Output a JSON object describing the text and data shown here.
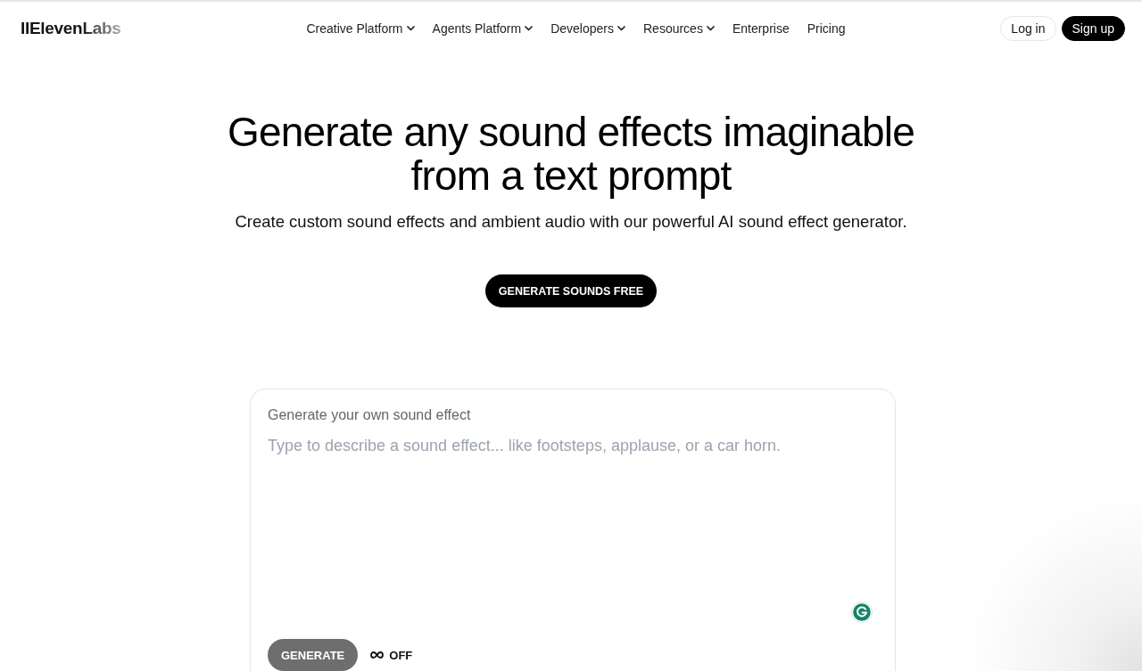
{
  "header": {
    "logo": "IIElevenLabs",
    "nav": [
      {
        "label": "Creative Platform",
        "has_menu": true
      },
      {
        "label": "Agents Platform",
        "has_menu": true
      },
      {
        "label": "Developers",
        "has_menu": true
      },
      {
        "label": "Resources",
        "has_menu": true
      },
      {
        "label": "Enterprise",
        "has_menu": false
      },
      {
        "label": "Pricing",
        "has_menu": false
      }
    ],
    "actions": [
      {
        "label": "Log in",
        "kind": "secondary"
      },
      {
        "label": "Sign up",
        "kind": "primary"
      }
    ]
  },
  "hero": {
    "title": "Generate any sound effects imaginable from a text prompt",
    "subtitle": "Create custom sound effects and ambient audio with our powerful AI sound effect generator.",
    "cta": "GENERATE SOUNDS FREE"
  },
  "generator": {
    "label": "Generate your own sound effect",
    "prompt": {
      "placeholder": "Type to describe a sound effect... like footsteps, applause, or a car horn."
    },
    "generate_button": {
      "label": "GENERATE",
      "disabled": true
    },
    "loop": {
      "label": "OFF"
    }
  }
}
